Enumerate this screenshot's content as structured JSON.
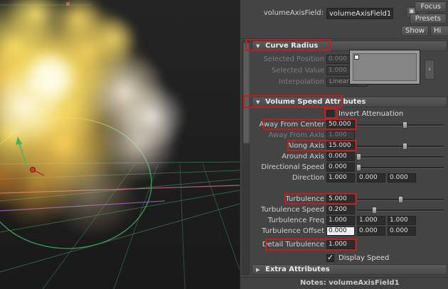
{
  "icons": {
    "check": "✓",
    "section_open": "▼",
    "section_closed": "▶",
    "dropdown": "▼",
    "ramp_expand": "›",
    "copy": "▣",
    "arrow": "↪"
  },
  "header": {
    "name_label": "volumeAxisField:",
    "name_value": "volumeAxisField1",
    "focus": "Focus",
    "presets": "Presets",
    "show": "Show",
    "hide": "Hi"
  },
  "curve_radius": {
    "title": "Curve Radius",
    "selected_position_label": "Selected Position",
    "selected_position_value": "0.000",
    "selected_value_label": "Selected Value",
    "selected_value_value": "1.000",
    "interpolation_label": "Interpolation",
    "interpolation_value": "Linear"
  },
  "volume_speed": {
    "title": "Volume Speed Attributes",
    "invert_attenuation_label": "Invert Attenuation",
    "away_from_center": {
      "label": "Away From Center",
      "value": "50.000",
      "slider": 0.55
    },
    "away_from_axis": {
      "label": "Away From Axis",
      "value": "1.000"
    },
    "along_axis": {
      "label": "Along Axis",
      "value": "15.000",
      "slider": 0.55
    },
    "around_axis": {
      "label": "Around Axis",
      "value": "0.000",
      "slider": 0.02
    },
    "directional_speed": {
      "label": "Directional Speed",
      "value": "0.000",
      "slider": 0.02
    },
    "direction": {
      "label": "Direction",
      "x": "1.000",
      "y": "0.000",
      "z": "0.000"
    },
    "turbulence": {
      "label": "Turbulence",
      "value": "5.000",
      "slider": 0.5
    },
    "turbulence_speed": {
      "label": "Turbulence Speed",
      "value": "0.200",
      "slider": 0.2
    },
    "turbulence_freq": {
      "label": "Turbulence Freq",
      "x": "1.000",
      "y": "1.000",
      "z": "1.000"
    },
    "turbulence_offset": {
      "label": "Turbulence Offset",
      "x": "0.000",
      "y": "0.000",
      "z": "0.000"
    },
    "detail_turbulence": {
      "label": "Detail Turbulence",
      "value": "1.000"
    },
    "display_speed_label": "Display Speed"
  },
  "extra_attributes": {
    "title": "Extra Attributes"
  },
  "notes_label": "Notes: volumeAxisField1",
  "colors": {
    "highlight": "#c01f1f"
  }
}
